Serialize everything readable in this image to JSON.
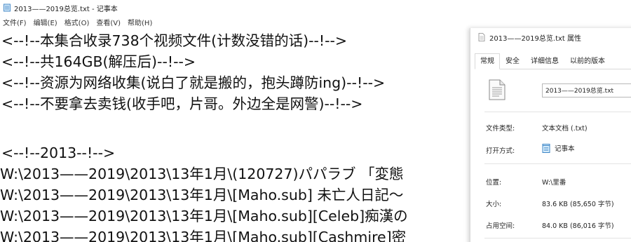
{
  "window": {
    "title": "2013——2019总览.txt - 记事本"
  },
  "menu": [
    {
      "label": "文件(F)"
    },
    {
      "label": "编辑(E)"
    },
    {
      "label": "格式(O)"
    },
    {
      "label": "查看(V)"
    },
    {
      "label": "帮助(H)"
    }
  ],
  "editor": {
    "lines": [
      "<--!--本集合收录738个视频文件(计数没错的话)--!-->",
      "<--!--共164GB(解压后)--!-->",
      "<--!--资源为网络收集(说白了就是搬的，抱头蹲防ing)--!-->",
      "<--!--不要拿去卖钱(收手吧，片哥。外边全是网警)--!-->",
      "",
      "<--!--2013--!-->",
      "W:\\2013——2019\\2013\\13年1月\\(120727)パパラブ 「変態",
      "W:\\2013——2019\\2013\\13年1月\\[Maho.sub] 未亡人日記～",
      "W:\\2013——2019\\2013\\13年1月\\[Maho.sub][Celeb]痴漢の",
      "W:\\2013——2019\\2013\\13年1月\\[Maho.sub][Cashmire]密"
    ]
  },
  "dialog": {
    "title": "2013——2019总览.txt 属性",
    "tabs": [
      {
        "label": "常规",
        "active": true
      },
      {
        "label": "安全",
        "active": false
      },
      {
        "label": "详细信息",
        "active": false
      },
      {
        "label": "以前的版本",
        "active": false
      }
    ],
    "filename": "2013——2019总览.txt",
    "type_label": "文件类型:",
    "type_value": "文本文档 (.txt)",
    "openwith_label": "打开方式:",
    "openwith_value": "记事本",
    "location_label": "位置:",
    "location_value": "W:\\里番",
    "size_label": "大小:",
    "size_value": "83.6 KB (85,650 字节)",
    "disk_label": "占用空间:",
    "disk_value": "84.0 KB (86,016 字节)"
  },
  "icons": {
    "app": "notepad-icon",
    "file": "text-file-icon",
    "openwith": "notepad-icon"
  }
}
